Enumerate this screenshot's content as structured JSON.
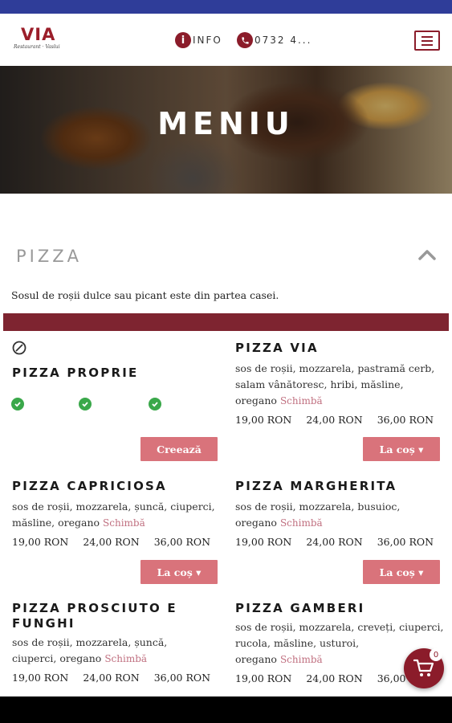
{
  "header": {
    "logo_text": "VIA",
    "logo_sub": "Restaurant · Vaslui",
    "info_label": "INFO",
    "phone_label": "0732 4...",
    "accent_color": "#8b1c2a"
  },
  "hero": {
    "title": "MENIU"
  },
  "section": {
    "title": "PIZZA",
    "note": "Sosul de roșii dulce sau picant este din partea casei.",
    "bar_color": "#7e2430"
  },
  "custom_pizza": {
    "name": "PIZZA PROPRIE",
    "button": "Creează",
    "checks": 3
  },
  "items": [
    {
      "name": "PIZZA VIA",
      "desc": "sos de roșii, mozzarela, pastramă cerb, salam vânătoresc, hribi, măsline, oregano",
      "change": "Schimbă",
      "prices": [
        "19,00 RON",
        "24,00 RON",
        "36,00 RON"
      ],
      "button": "La coș ▾"
    },
    {
      "name": "PIZZA CAPRICIOSA",
      "desc": "sos de roșii, mozzarela, șuncă, ciuperci, măsline, oregano",
      "change": "Schimbă",
      "prices": [
        "19,00 RON",
        "24,00 RON",
        "36,00 RON"
      ],
      "button": "La coș ▾"
    },
    {
      "name": "PIZZA MARGHERITA",
      "desc": "sos de roșii, mozzarela, busuioc, oregano",
      "change": "Schimbă",
      "prices": [
        "19,00 RON",
        "24,00 RON",
        "36,00 RON"
      ],
      "button": "La coș ▾"
    },
    {
      "name": "PIZZA PROSCIUTO E FUNGHI",
      "desc": "sos de roșii, mozzarela, șuncă, ciuperci, oregano",
      "change": "Schimbă",
      "prices": [
        "19,00 RON",
        "24,00 RON",
        "36,00 RON"
      ]
    },
    {
      "name": "PIZZA GAMBERI",
      "desc": "sos de roșii, mozzarela, creveți, ciuperci, rucola, măsline, usturoi, oregano",
      "change": "Schimbă",
      "prices": [
        "19,00 RON",
        "24,00 RON",
        "36,00 RON"
      ]
    }
  ],
  "cart": {
    "count": "0",
    "icon": "shopping-cart-icon"
  }
}
